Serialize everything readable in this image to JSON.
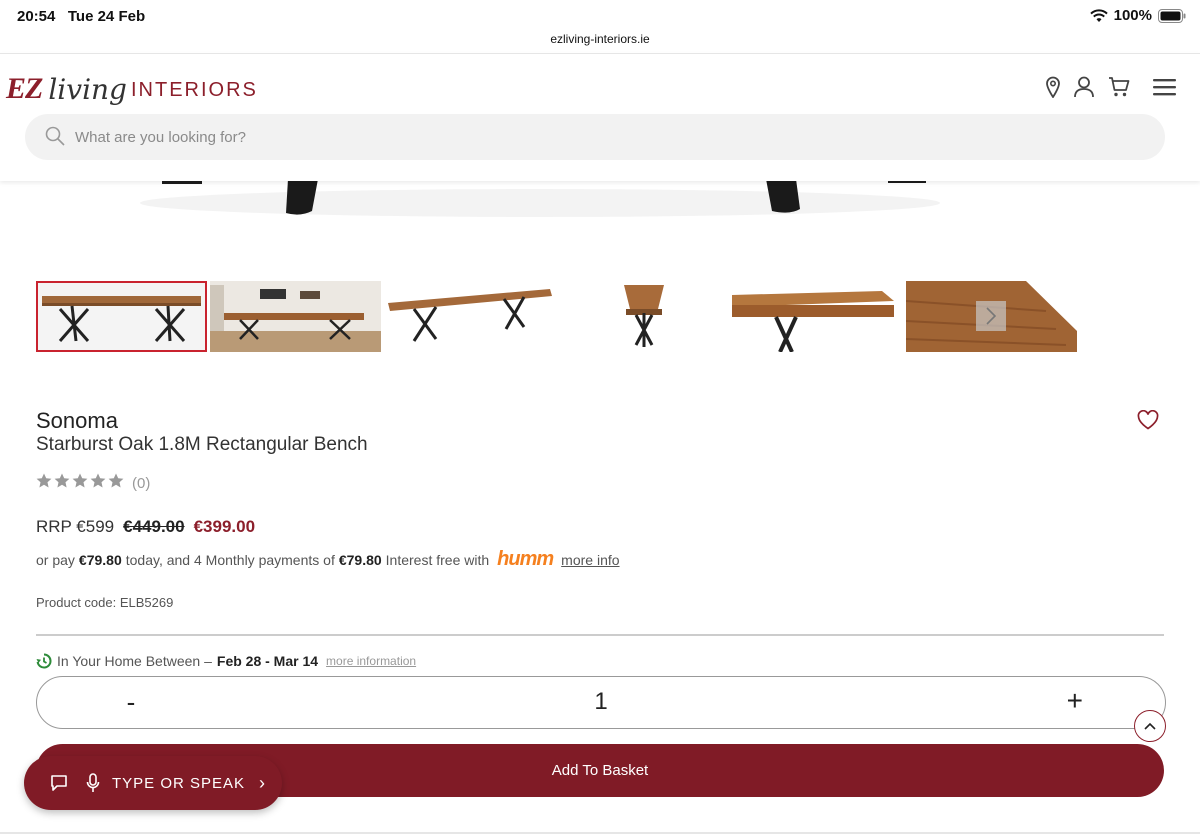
{
  "status_bar": {
    "time_date": "20:54   Tue 24 Feb",
    "battery": "100%"
  },
  "browser": {
    "url": "ezliving-interiors.ie"
  },
  "header": {
    "logo": {
      "ez": "EZ",
      "living": "living",
      "interiors": "INTERIORS"
    },
    "search_placeholder": "What are you looking for?",
    "icons": [
      "location-icon",
      "account-icon",
      "cart-icon",
      "menu-icon"
    ]
  },
  "gallery": {
    "thumbnail_count": 6,
    "active_index": 0
  },
  "product": {
    "brand": "Sonoma",
    "name": "Starburst Oak 1.8M Rectangular Bench",
    "rating_count": "(0)",
    "rating_stars": 0,
    "rrp": "RRP €599",
    "was_price": "€449.00",
    "price": "€399.00",
    "finance": {
      "prefix": "or pay",
      "today_amount": "€79.80",
      "middle": "today, and 4 Monthly payments of",
      "monthly_amount": "€79.80",
      "suffix": "Interest free with",
      "provider": "humm",
      "link": "more info"
    },
    "product_code": "Product code: ELB5269"
  },
  "delivery": {
    "label": "In Your Home Between –",
    "dates": "Feb 28 - Mar 14",
    "link": "more information"
  },
  "quantity": {
    "minus": "-",
    "value": "1",
    "plus": "+"
  },
  "add_to_basket": "Add To Basket",
  "speak_widget": {
    "label": "TYPE OR SPEAK",
    "chevron": "›"
  },
  "colors": {
    "brand": "#801b26",
    "accent_red": "#c9232f",
    "humm_orange": "#f5801f"
  }
}
